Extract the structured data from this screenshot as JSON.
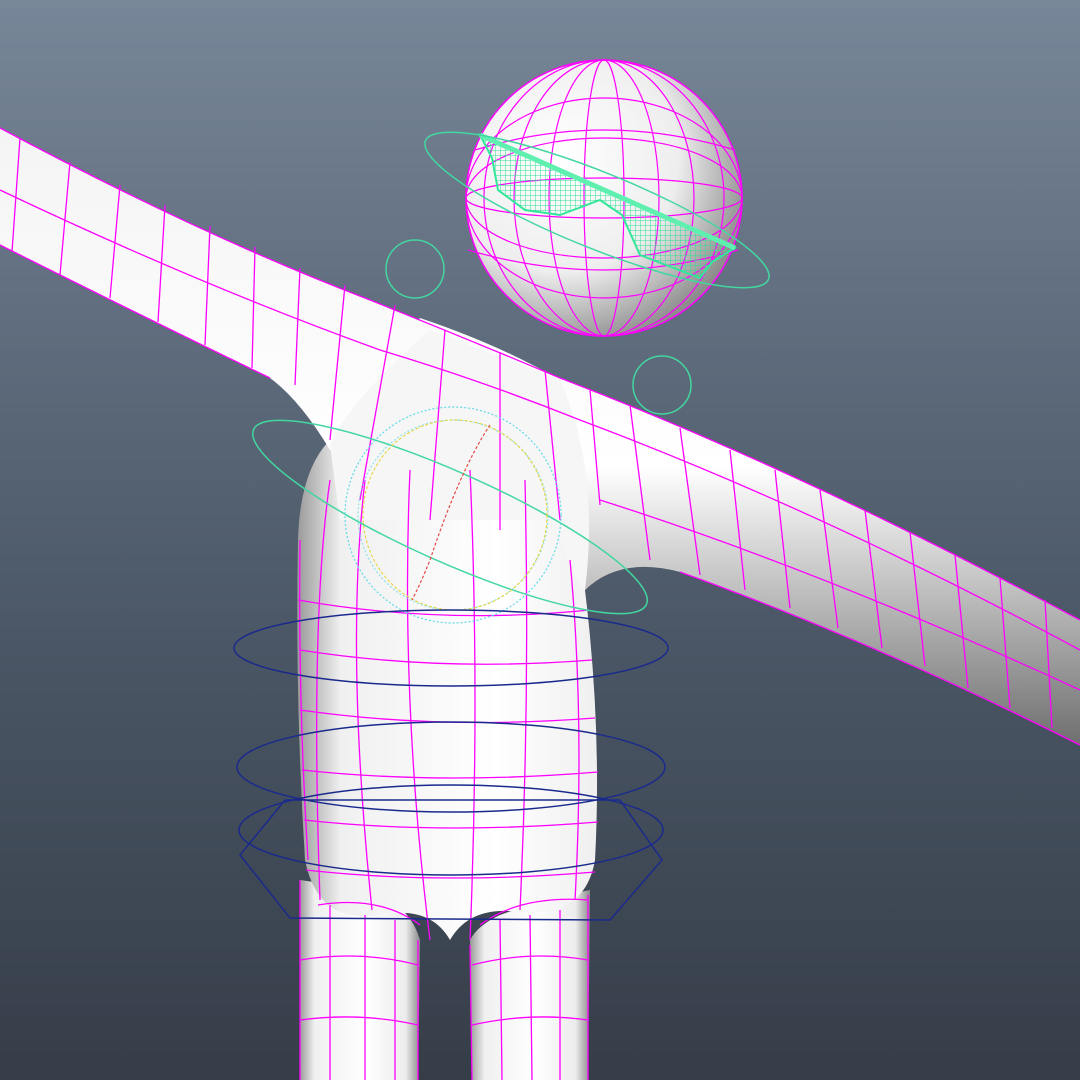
{
  "viewport": {
    "background_top": "#788699",
    "background_bottom": "#353d48",
    "overlay_text": []
  },
  "scene": {
    "objects": [
      {
        "name": "character-body-mesh",
        "kind": "polygon-mesh",
        "wireframe_color": "#ff00ff",
        "shading": "white-smooth"
      },
      {
        "name": "head-sphere",
        "kind": "polygon-mesh",
        "wireframe_color": "#ff00ff"
      },
      {
        "name": "sunglasses",
        "kind": "polygon-mesh",
        "wireframe_color": "#33e69a"
      },
      {
        "name": "head-control",
        "kind": "nurbs-curve",
        "color": "#43d7a0"
      },
      {
        "name": "shoulder-controls",
        "kind": "nurbs-curve",
        "color": "#43d7a0"
      },
      {
        "name": "chest-control",
        "kind": "nurbs-curve",
        "color": "#43d7a0"
      },
      {
        "name": "spine-controls",
        "kind": "nurbs-curve",
        "color": "#1a2a8c"
      },
      {
        "name": "hip-control",
        "kind": "nurbs-curve",
        "color": "#1a2a8c"
      },
      {
        "name": "chest-manipulator",
        "kind": "rotate-manipulator",
        "colors": [
          "#e6d84a",
          "#5fd9e6",
          "#e64a4a"
        ]
      }
    ]
  }
}
